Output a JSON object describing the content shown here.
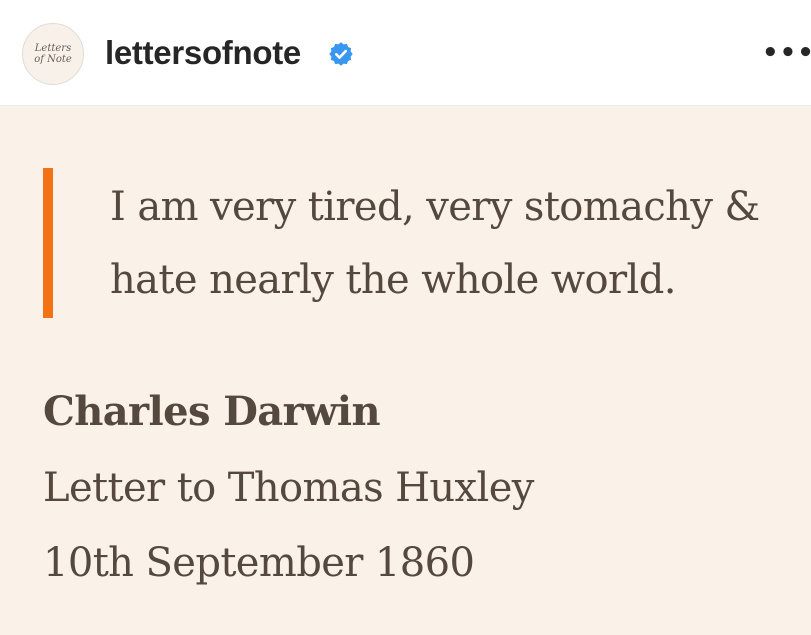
{
  "header": {
    "avatar_text_line1": "Letters",
    "avatar_text_line2": "of Note",
    "username": "lettersofnote",
    "verified_icon": "verified-badge-icon",
    "more_icon": "more-options-icon",
    "more_label": "•••"
  },
  "post": {
    "quote_line1": "I am very tired, very stomachy &",
    "quote_line2": "hate nearly the whole world.",
    "author": "Charles Darwin",
    "detail_line1": "Letter to Thomas Huxley",
    "detail_line2": "10th September 1860"
  },
  "colors": {
    "post_background": "#faf1e8",
    "quote_bar": "#f47216",
    "text": "#54483f",
    "verified": "#3897f0"
  }
}
